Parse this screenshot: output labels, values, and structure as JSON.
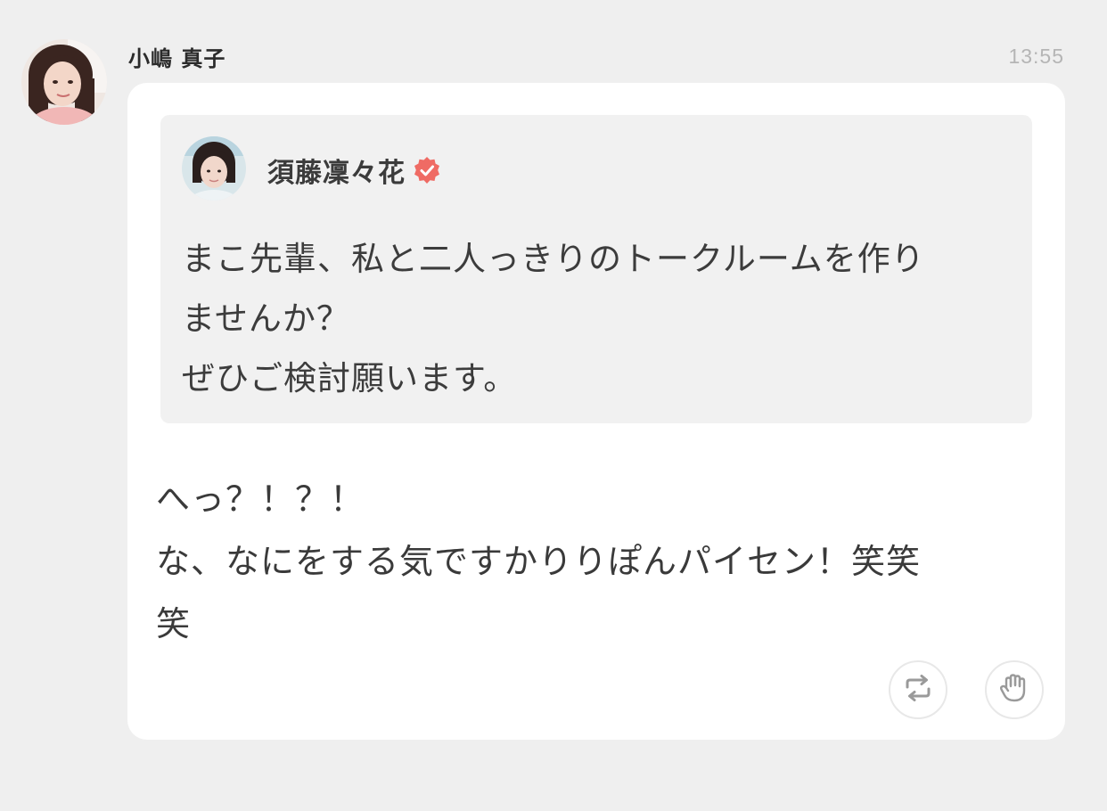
{
  "message": {
    "sender_name": "小嶋 真子",
    "timestamp": "13:55",
    "quote": {
      "author_name": "須藤凜々花",
      "verified": true,
      "text": "まこ先輩、私と二人っきりのトークルームを作り\nませんか？\nぜひご検討願います。"
    },
    "reply_text": "へっ？！？！\nな、なにをする気ですかりりぽんパイセン！笑笑\n笑",
    "actions": [
      {
        "icon": "repost-icon"
      },
      {
        "icon": "clap-icon"
      }
    ]
  },
  "colors": {
    "background": "#efefef",
    "card": "#ffffff",
    "quote_background": "#f1f1f1",
    "verified_badge": "#ef6b64",
    "timestamp": "#b5b5b5",
    "icon": "#9a9a9a"
  }
}
